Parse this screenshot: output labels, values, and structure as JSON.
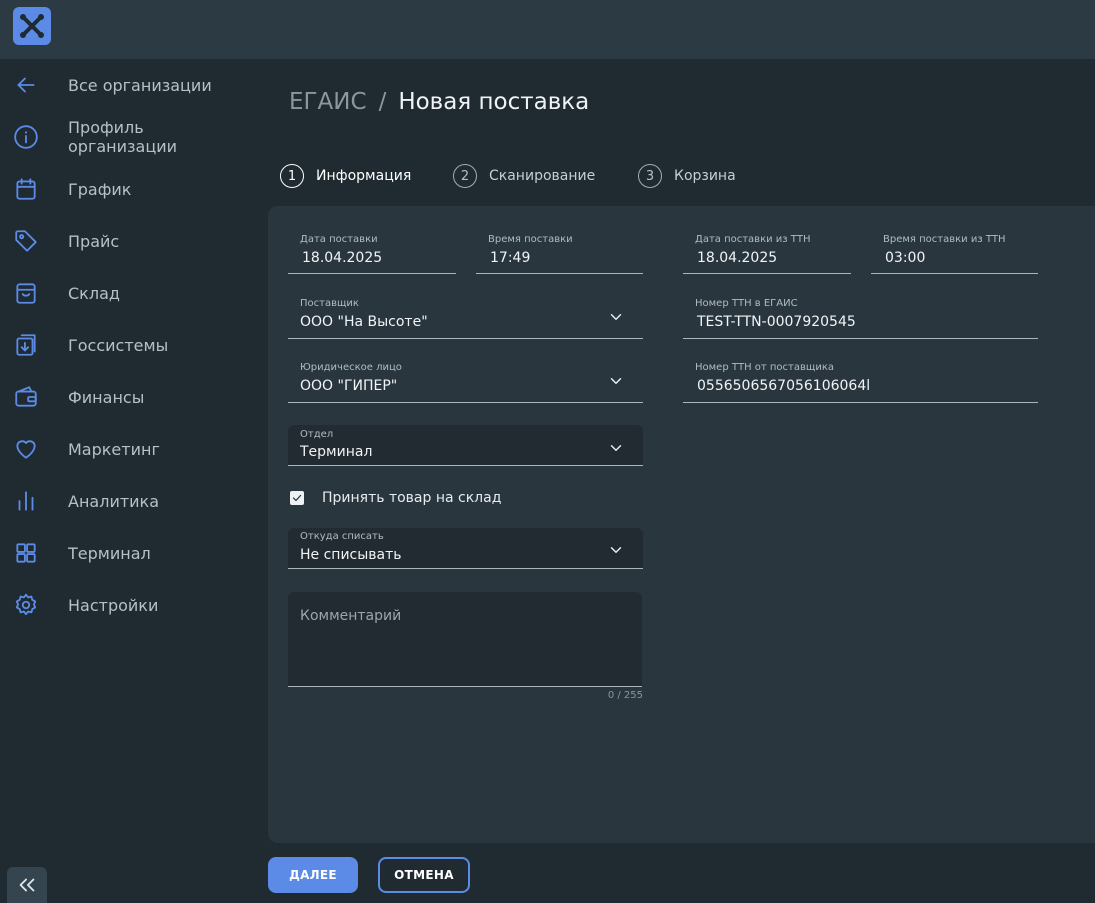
{
  "sidebar": {
    "items": [
      {
        "label": "Все организации",
        "icon": "arrow-left-icon"
      },
      {
        "label": "Профиль\nорганизации",
        "icon": "info-icon"
      },
      {
        "label": "График",
        "icon": "calendar-icon"
      },
      {
        "label": "Прайс",
        "icon": "tag-icon"
      },
      {
        "label": "Склад",
        "icon": "box-icon"
      },
      {
        "label": "Госсистемы",
        "icon": "import-icon"
      },
      {
        "label": "Финансы",
        "icon": "wallet-icon"
      },
      {
        "label": "Маркетинг",
        "icon": "heart-icon"
      },
      {
        "label": "Аналитика",
        "icon": "bar-chart-icon"
      },
      {
        "label": "Терминал",
        "icon": "grid-icon"
      },
      {
        "label": "Настройки",
        "icon": "gear-icon"
      }
    ]
  },
  "breadcrumb": {
    "root": "ЕГАИС",
    "separator": "/",
    "current": "Новая поставка"
  },
  "steps": [
    {
      "num": "1",
      "label": "Информация",
      "active": true
    },
    {
      "num": "2",
      "label": "Сканирование",
      "active": false
    },
    {
      "num": "3",
      "label": "Корзина",
      "active": false
    }
  ],
  "form": {
    "delivery_date": {
      "label": "Дата поставки",
      "value": "18.04.2025"
    },
    "delivery_time": {
      "label": "Время поставки",
      "value": "17:49"
    },
    "ttn_date": {
      "label": "Дата поставки из ТТН",
      "value": "18.04.2025"
    },
    "ttn_time": {
      "label": "Время поставки из ТТН",
      "value": "03:00"
    },
    "supplier": {
      "label": "Поставщик",
      "value": "ООО \"На Высоте\""
    },
    "egais_ttn": {
      "label": "Номер ТТН в ЕГАИС",
      "value": "TEST-TTN-0007920545"
    },
    "legal_entity": {
      "label": "Юридическое лицо",
      "value": "ООО \"ГИПЕР\""
    },
    "supplier_ttn": {
      "label": "Номер ТТН от поставщика",
      "value": "0556506567056106064l"
    },
    "department": {
      "label": "Отдел",
      "value": "Терминал"
    },
    "accept_to_stock": {
      "label": "Принять товар на склад",
      "checked": true
    },
    "write_off_from": {
      "label": "Откуда списать",
      "value": "Не списывать"
    },
    "comment": {
      "placeholder": "Комментарий",
      "counter": "0 / 255"
    }
  },
  "buttons": {
    "next": "ДАЛЕЕ",
    "cancel": "ОТМЕНА"
  },
  "colors": {
    "accent": "#5b8be6",
    "background": "#1f2a31",
    "panel": "#2a363e",
    "topbar": "#2c3a43"
  }
}
